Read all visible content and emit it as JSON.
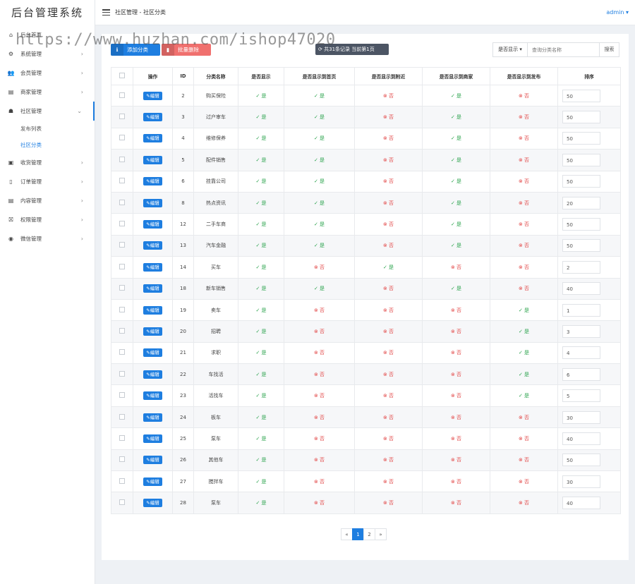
{
  "app": {
    "title": "后台管理系统"
  },
  "header": {
    "breadcrumb": "社区管理 - 社区分类",
    "user": "admin"
  },
  "sidebar": {
    "items": [
      {
        "label": "后台首页",
        "icon": "home-icon",
        "chevron": ""
      },
      {
        "label": "系统管理",
        "icon": "gear-icon",
        "chevron": "›"
      },
      {
        "label": "会员管理",
        "icon": "users-icon",
        "chevron": "›"
      },
      {
        "label": "商家管理",
        "icon": "shop-icon",
        "chevron": "›"
      },
      {
        "label": "社区管理",
        "icon": "community-icon",
        "chevron": "⌄"
      },
      {
        "label": "收货管理",
        "icon": "package-icon",
        "chevron": "›"
      },
      {
        "label": "订单管理",
        "icon": "clipboard-icon",
        "chevron": "›"
      },
      {
        "label": "内容管理",
        "icon": "document-icon",
        "chevron": "›"
      },
      {
        "label": "权限管理",
        "icon": "permission-icon",
        "chevron": "›"
      },
      {
        "label": "微信管理",
        "icon": "wechat-icon",
        "chevron": "›"
      }
    ],
    "sub_items": [
      {
        "label": "发布列表"
      },
      {
        "label": "社区分类"
      }
    ]
  },
  "toolbar": {
    "add_label": "添加分类",
    "delete_label": "批量删除",
    "record_info": "共31条记录 当前第1页",
    "filter_label": "是否显示",
    "search_placeholder": "查询分类名称",
    "search_button": "搜索"
  },
  "table": {
    "headers": [
      "",
      "操作",
      "ID",
      "分类名称",
      "是否显示",
      "是否显示到首页",
      "是否显示到附近",
      "是否显示到商家",
      "是否显示到发布",
      "排序"
    ],
    "edit_label": "编辑",
    "yes_label": "是",
    "no_label": "否",
    "rows": [
      {
        "id": "2",
        "name": "购买保险",
        "flags": [
          true,
          true,
          false,
          true,
          false
        ],
        "sort": "50"
      },
      {
        "id": "3",
        "name": "过户审车",
        "flags": [
          true,
          true,
          false,
          true,
          false
        ],
        "sort": "50"
      },
      {
        "id": "4",
        "name": "维修保养",
        "flags": [
          true,
          true,
          false,
          true,
          false
        ],
        "sort": "50"
      },
      {
        "id": "5",
        "name": "配件销售",
        "flags": [
          true,
          true,
          false,
          true,
          false
        ],
        "sort": "50"
      },
      {
        "id": "6",
        "name": "挂靠公司",
        "flags": [
          true,
          true,
          false,
          true,
          false
        ],
        "sort": "50"
      },
      {
        "id": "8",
        "name": "热点资讯",
        "flags": [
          true,
          true,
          false,
          true,
          false
        ],
        "sort": "20"
      },
      {
        "id": "12",
        "name": "二手车商",
        "flags": [
          true,
          true,
          false,
          true,
          false
        ],
        "sort": "50"
      },
      {
        "id": "13",
        "name": "汽车金融",
        "flags": [
          true,
          true,
          false,
          true,
          false
        ],
        "sort": "50"
      },
      {
        "id": "14",
        "name": "买车",
        "flags": [
          true,
          false,
          true,
          false,
          false
        ],
        "sort": "2"
      },
      {
        "id": "18",
        "name": "新车销售",
        "flags": [
          true,
          true,
          false,
          true,
          false
        ],
        "sort": "40"
      },
      {
        "id": "19",
        "name": "卖车",
        "flags": [
          true,
          false,
          false,
          false,
          true
        ],
        "sort": "1"
      },
      {
        "id": "20",
        "name": "招聘",
        "flags": [
          true,
          false,
          false,
          false,
          true
        ],
        "sort": "3"
      },
      {
        "id": "21",
        "name": "求职",
        "flags": [
          true,
          false,
          false,
          false,
          true
        ],
        "sort": "4"
      },
      {
        "id": "22",
        "name": "车找活",
        "flags": [
          true,
          false,
          false,
          false,
          true
        ],
        "sort": "6"
      },
      {
        "id": "23",
        "name": "活找车",
        "flags": [
          true,
          false,
          false,
          false,
          true
        ],
        "sort": "5"
      },
      {
        "id": "24",
        "name": "板车",
        "flags": [
          true,
          false,
          false,
          false,
          false
        ],
        "sort": "30"
      },
      {
        "id": "25",
        "name": "泵车",
        "flags": [
          true,
          false,
          false,
          false,
          false
        ],
        "sort": "40"
      },
      {
        "id": "26",
        "name": "其他车",
        "flags": [
          true,
          false,
          false,
          false,
          false
        ],
        "sort": "50"
      },
      {
        "id": "27",
        "name": "搅拌车",
        "flags": [
          true,
          false,
          false,
          false,
          false
        ],
        "sort": "30"
      },
      {
        "id": "28",
        "name": "泵车",
        "flags": [
          true,
          false,
          false,
          false,
          false
        ],
        "sort": "40"
      }
    ]
  },
  "pagination": {
    "prev": "«",
    "pages": [
      "1",
      "2"
    ],
    "current": "1",
    "next": "»"
  },
  "watermark": "https://www.huzhan.com/ishop47020",
  "colors": {
    "primary": "#1e7ee0",
    "danger": "#f0706e",
    "yes": "#2ea44f",
    "no": "#e34c4c",
    "dark": "#4c5564"
  }
}
